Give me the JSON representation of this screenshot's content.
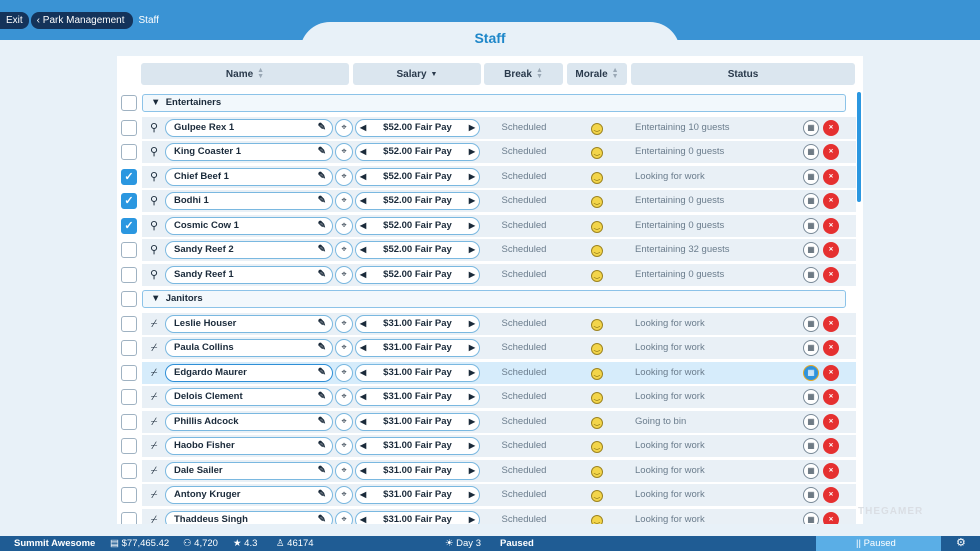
{
  "breadcrumb": {
    "exit": "Exit",
    "park_management": "‹ Park Management",
    "staff": "Staff"
  },
  "title": "Staff",
  "columns": {
    "name": "Name",
    "salary": "Salary",
    "break": "Break",
    "morale": "Morale",
    "status": "Status"
  },
  "groups": [
    {
      "label": "Entertainers",
      "members": [
        {
          "name": "Gulpee Rex 1",
          "salary": "$52.00 Fair Pay",
          "break": "Scheduled",
          "status": "Entertaining 10 guests",
          "checked": false
        },
        {
          "name": "King Coaster 1",
          "salary": "$52.00 Fair Pay",
          "break": "Scheduled",
          "status": "Entertaining 0 guests",
          "checked": false
        },
        {
          "name": "Chief Beef 1",
          "salary": "$52.00 Fair Pay",
          "break": "Scheduled",
          "status": "Looking for work",
          "checked": true
        },
        {
          "name": "Bodhi 1",
          "salary": "$52.00 Fair Pay",
          "break": "Scheduled",
          "status": "Entertaining 0 guests",
          "checked": true
        },
        {
          "name": "Cosmic Cow 1",
          "salary": "$52.00 Fair Pay",
          "break": "Scheduled",
          "status": "Entertaining 0 guests",
          "checked": true
        },
        {
          "name": "Sandy Reef 2",
          "salary": "$52.00 Fair Pay",
          "break": "Scheduled",
          "status": "Entertaining 32 guests",
          "checked": false
        },
        {
          "name": "Sandy Reef 1",
          "salary": "$52.00 Fair Pay",
          "break": "Scheduled",
          "status": "Entertaining 0 guests",
          "checked": false
        }
      ]
    },
    {
      "label": "Janitors",
      "members": [
        {
          "name": "Leslie Houser",
          "salary": "$31.00 Fair Pay",
          "break": "Scheduled",
          "status": "Looking for work",
          "checked": false
        },
        {
          "name": "Paula Collins",
          "salary": "$31.00 Fair Pay",
          "break": "Scheduled",
          "status": "Looking for work",
          "checked": false
        },
        {
          "name": "Edgardo Maurer",
          "salary": "$31.00 Fair Pay",
          "break": "Scheduled",
          "status": "Looking for work",
          "checked": false,
          "selected": true
        },
        {
          "name": "Delois Clement",
          "salary": "$31.00 Fair Pay",
          "break": "Scheduled",
          "status": "Looking for work",
          "checked": false
        },
        {
          "name": "Phillis Adcock",
          "salary": "$31.00 Fair Pay",
          "break": "Scheduled",
          "status": "Going to bin",
          "checked": false
        },
        {
          "name": "Haobo Fisher",
          "salary": "$31.00 Fair Pay",
          "break": "Scheduled",
          "status": "Looking for work",
          "checked": false
        },
        {
          "name": "Dale Sailer",
          "salary": "$31.00 Fair Pay",
          "break": "Scheduled",
          "status": "Looking for work",
          "checked": false
        },
        {
          "name": "Antony Kruger",
          "salary": "$31.00 Fair Pay",
          "break": "Scheduled",
          "status": "Looking for work",
          "checked": false
        },
        {
          "name": "Thaddeus Singh",
          "salary": "$31.00 Fair Pay",
          "break": "Scheduled",
          "status": "Looking for work",
          "checked": false
        }
      ]
    }
  ],
  "icons": {
    "entertainer": "speech-bubble-icon",
    "janitor": "broom-icon",
    "edit": "pencil-icon",
    "locate": "map-pin-icon",
    "schedule": "calendar-icon",
    "fire": "fire-staff-icon"
  },
  "bottom": {
    "park_name": "Summit Awesome",
    "money": "$77,465.42",
    "guests": "4,720",
    "rating": "4.3",
    "research": "46174",
    "day": "Day 3",
    "game_state": "Paused",
    "right_status": "|| Paused"
  },
  "watermark": "THEGAMER",
  "colors": {
    "accent": "#2b97e0",
    "title": "#1e87c9",
    "fire": "#e53030",
    "bottom_bar": "#1f5c94"
  }
}
